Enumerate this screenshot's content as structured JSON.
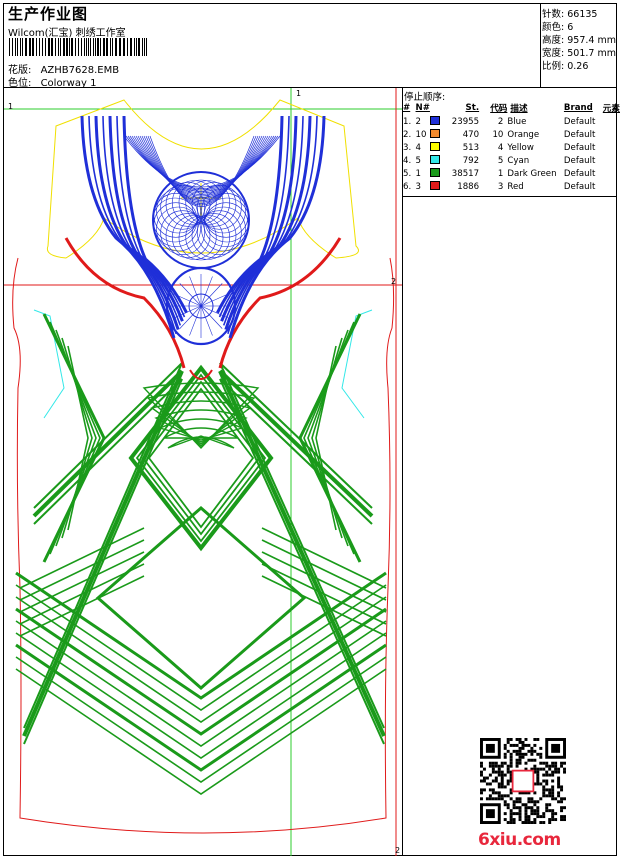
{
  "header": {
    "title": "生产作业图",
    "company": "Wilcom(汇宝) 刺绣工作室",
    "design_label": "花版:",
    "design_value": "AZHB7628.EMB",
    "colorway_label": "色位:",
    "colorway_value": "Colorway 1"
  },
  "stats": [
    {
      "label": "针数:",
      "value": "66135"
    },
    {
      "label": "颜色:",
      "value": "6"
    },
    {
      "label": "高度:",
      "value": "957.4 mm"
    },
    {
      "label": "宽度:",
      "value": "501.7 mm"
    },
    {
      "label": "比例:",
      "value": "0.26"
    }
  ],
  "stop_sequence": {
    "title": "停止顺序:",
    "headers": [
      "#",
      "N#",
      "St.",
      "代码",
      "描述",
      "Brand",
      "元素"
    ],
    "rows": [
      {
        "idx": "1.",
        "n": "2",
        "color": "#1f2fd8",
        "st": "23955",
        "code": "2",
        "desc": "Blue",
        "brand": "Default"
      },
      {
        "idx": "2.",
        "n": "10",
        "color": "#f28a2e",
        "st": "470",
        "code": "10",
        "desc": "Orange",
        "brand": "Default"
      },
      {
        "idx": "3.",
        "n": "4",
        "color": "#ffff00",
        "st": "513",
        "code": "4",
        "desc": "Yellow",
        "brand": "Default"
      },
      {
        "idx": "4.",
        "n": "5",
        "color": "#33e8e8",
        "st": "792",
        "code": "5",
        "desc": "Cyan",
        "brand": "Default"
      },
      {
        "idx": "5.",
        "n": "1",
        "color": "#1a9a1a",
        "st": "38517",
        "code": "1",
        "desc": "Dark Green",
        "brand": "Default"
      },
      {
        "idx": "6.",
        "n": "3",
        "color": "#e01a1a",
        "st": "1886",
        "code": "3",
        "desc": "Red",
        "brand": "Default"
      }
    ]
  },
  "guides": {
    "top_left": "1",
    "top_mid": "1",
    "right_mid": "2",
    "bottom_right": "2"
  },
  "watermark": "6xiu.com",
  "colors": {
    "blue": "#1f2fd8",
    "green": "#1a9a1a",
    "red": "#e01a1a",
    "yellow": "#f0e000",
    "cyan": "#33e8e8",
    "guide_green": "#2ecc2e"
  }
}
